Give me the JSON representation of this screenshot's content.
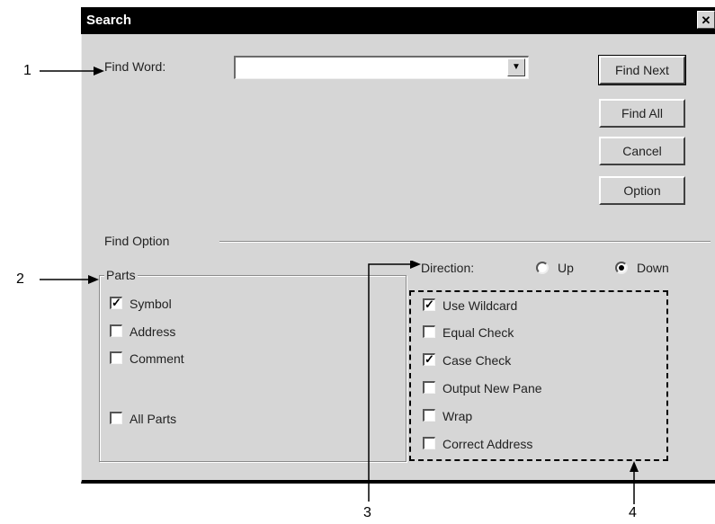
{
  "window": {
    "title": "Search",
    "close_glyph": "✕"
  },
  "find_word": {
    "label": "Find Word:",
    "value": "",
    "dropdown_glyph": "▼"
  },
  "buttons": {
    "find_next": "Find Next",
    "find_all": "Find All",
    "cancel": "Cancel",
    "option": "Option"
  },
  "find_option": {
    "label": "Find Option"
  },
  "parts": {
    "title": "Parts",
    "items": [
      {
        "label": "Symbol",
        "checked": true
      },
      {
        "label": "Address",
        "checked": false
      },
      {
        "label": "Comment",
        "checked": false
      },
      {
        "label": "All Parts",
        "checked": false
      }
    ]
  },
  "direction": {
    "label": "Direction:",
    "options": [
      {
        "label": "Up",
        "selected": false
      },
      {
        "label": "Down",
        "selected": true
      }
    ]
  },
  "options": {
    "items": [
      {
        "label": "Use Wildcard",
        "checked": true
      },
      {
        "label": "Equal Check",
        "checked": false
      },
      {
        "label": "Case Check",
        "checked": true
      },
      {
        "label": "Output New Pane",
        "checked": false
      },
      {
        "label": "Wrap",
        "checked": false
      },
      {
        "label": "Correct Address",
        "checked": false
      }
    ]
  },
  "callouts": [
    "1",
    "2",
    "3",
    "4"
  ],
  "check_glyph": "✓"
}
